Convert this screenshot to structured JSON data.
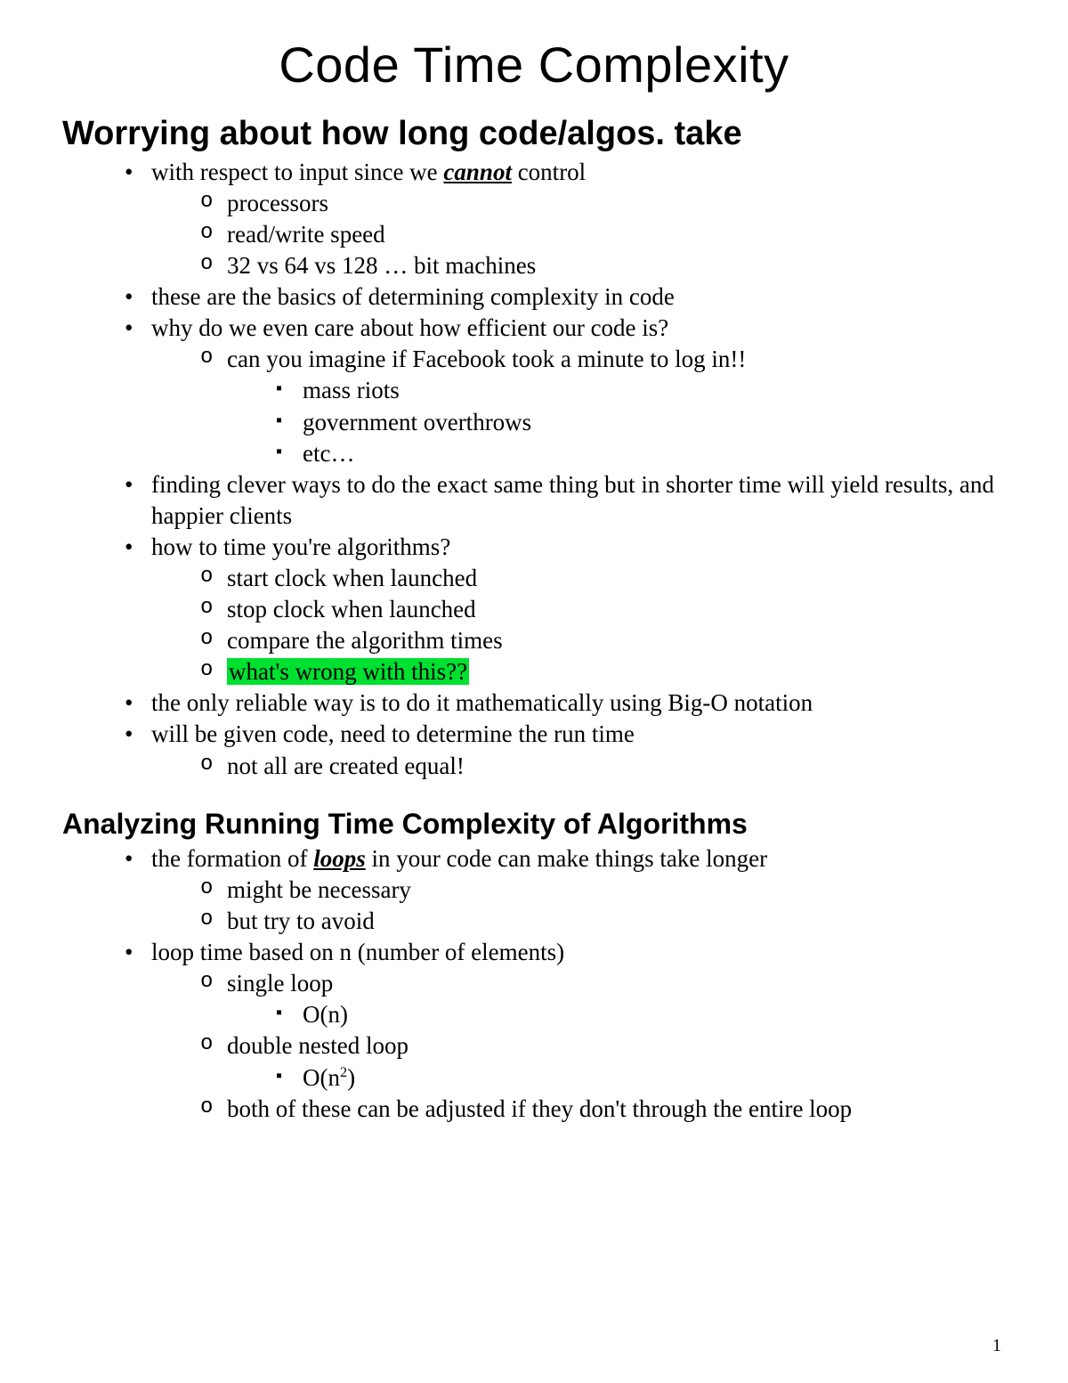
{
  "title": "Code Time Complexity",
  "page_number": "1",
  "section1": {
    "heading": "Worrying about how long code/algos. take",
    "b1_pre": "with respect to input since we ",
    "b1_emph": "cannot",
    "b1_post": " control",
    "b1_sub": [
      "processors",
      "read/write speed",
      "32 vs 64 vs 128 … bit machines"
    ],
    "b2": "these are the basics of determining complexity in code",
    "b3": "why do we even care about how efficient our code is?",
    "b3_sub1": "can you imagine if Facebook took a minute to log in!!",
    "b3_sub1_sub": [
      "mass riots",
      "government overthrows",
      "etc…"
    ],
    "b4": "finding clever ways to do the exact same thing but in shorter time will yield results, and happier clients",
    "b5": "how to time you're algorithms?",
    "b5_sub": [
      "start clock when launched",
      "stop clock when launched",
      "compare the algorithm times"
    ],
    "b5_sub_hl": "what's wrong with this??",
    "b6": "the only reliable way is to do it mathematically using Big-O notation",
    "b7": "will be given code, need to determine the run time",
    "b7_sub": [
      "not all are created equal!"
    ]
  },
  "section2": {
    "heading": "Analyzing Running Time Complexity of Algorithms",
    "b1_pre": "the formation of ",
    "b1_emph": "loops",
    "b1_post": " in your code can make things take longer",
    "b1_sub": [
      "might be necessary",
      "but try to avoid"
    ],
    "b2": "loop time based on n (number of elements)",
    "b2_sub1": "single loop",
    "b2_sub1_sub1": "O(n)",
    "b2_sub2": "double nested loop",
    "b2_sub2_sub1_pre": "O(n",
    "b2_sub2_sub1_sup": "2",
    "b2_sub2_sub1_post": ")",
    "b2_sub3": "both of these can be adjusted if they don't through the entire loop"
  }
}
